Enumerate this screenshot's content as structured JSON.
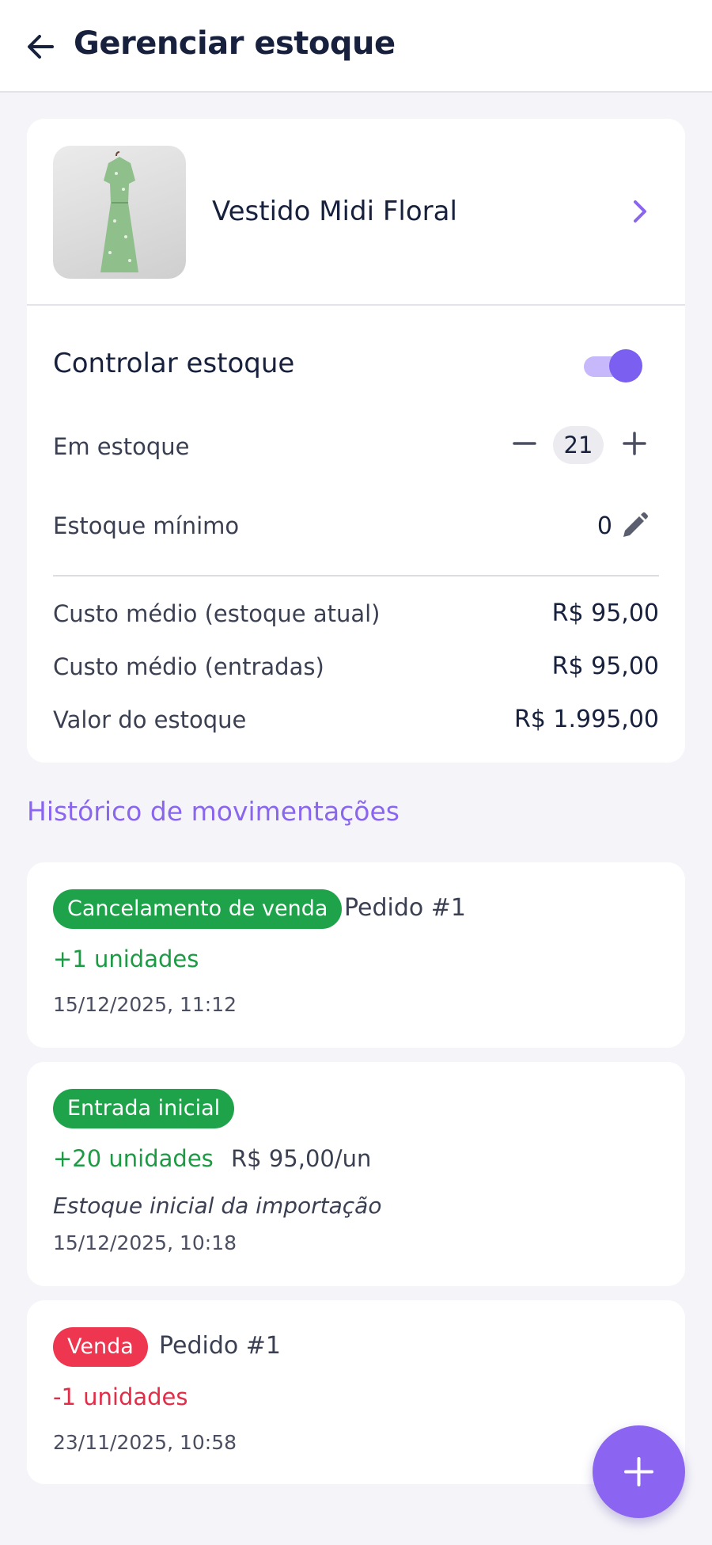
{
  "header": {
    "back_icon": "arrow-left-icon",
    "title": "Gerenciar estoque"
  },
  "product": {
    "name": "Vestido Midi Floral",
    "image_desc": "green floral dress on hanger",
    "chevron_icon": "chevron-right-icon"
  },
  "stock": {
    "control_label": "Controlar estoque",
    "control_enabled": true,
    "in_stock_label": "Em estoque",
    "in_stock_value": "21",
    "min_stock_label": "Estoque mínimo",
    "min_stock_value": "0",
    "costs": [
      {
        "label": "Custo médio (estoque atual)",
        "value": "R$ 95,00"
      },
      {
        "label": "Custo médio (entradas)",
        "value": "R$ 95,00"
      },
      {
        "label": "Valor do estoque",
        "value": "R$ 1.995,00"
      }
    ]
  },
  "history": {
    "title": "Histórico de movimentações",
    "items": [
      {
        "badge": "Cancelamento de venda",
        "badge_color": "#1fa34a",
        "order": "Pedido #1",
        "qty": "+1 unidades",
        "date": "15/12/2025, 11:12"
      },
      {
        "badge": "Entrada inicial",
        "badge_color": "#1fa34a",
        "qty": "+20 unidades",
        "unit_cost": "R$ 95,00/un",
        "note": "Estoque inicial da importação",
        "date": "15/12/2025, 10:18"
      },
      {
        "badge": "Venda",
        "badge_color": "#ee3650",
        "order": "Pedido #1",
        "qty": "-1 unidades",
        "date": "23/11/2025, 10:58"
      }
    ]
  },
  "colors": {
    "accent": "#8a66ef",
    "positive": "#1d9a44",
    "negative": "#e22d48"
  },
  "fab_icon": "plus-icon"
}
